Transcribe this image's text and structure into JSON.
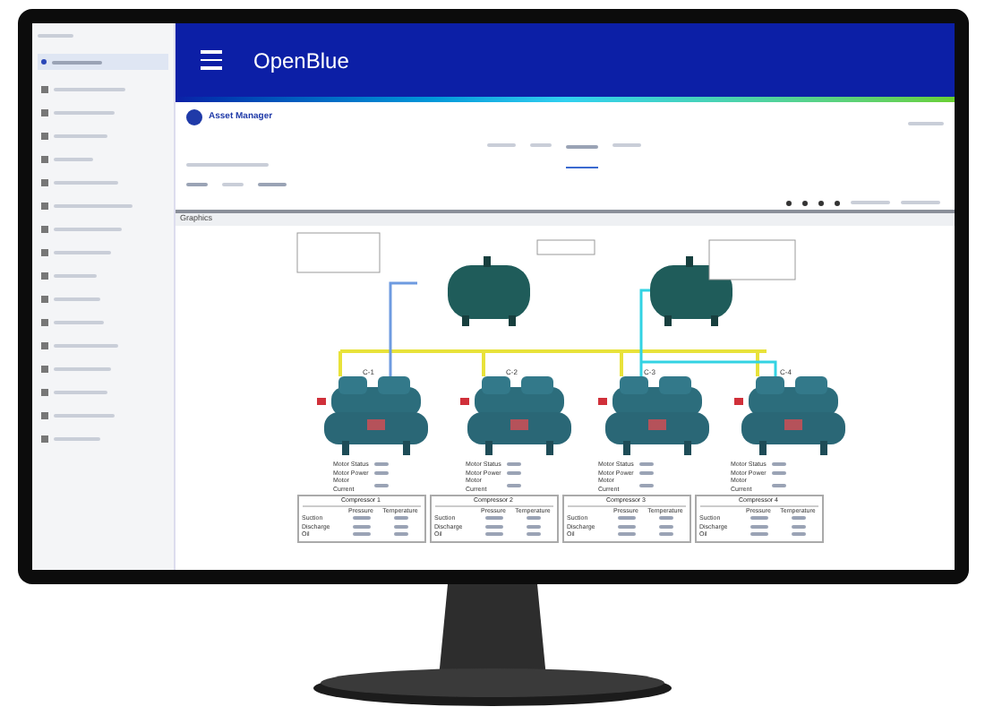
{
  "header": {
    "brand": "OpenBlue"
  },
  "sidebar": {
    "items": [
      {
        "selected": true
      },
      {
        "selected": false
      },
      {
        "selected": false
      },
      {
        "selected": false
      },
      {
        "selected": false
      },
      {
        "selected": false
      },
      {
        "selected": false
      },
      {
        "selected": false
      },
      {
        "selected": false
      },
      {
        "selected": false
      },
      {
        "selected": false
      },
      {
        "selected": false
      },
      {
        "selected": false
      },
      {
        "selected": false
      },
      {
        "selected": false
      },
      {
        "selected": false
      },
      {
        "selected": false
      }
    ]
  },
  "page": {
    "title": "Asset Manager"
  },
  "panel": {
    "title": "Graphics"
  },
  "compressors": [
    {
      "label": "C-1",
      "title": "Compressor 1",
      "status_labels": [
        "Motor Status",
        "Motor Power",
        "Motor Current"
      ],
      "rows": [
        "Suction",
        "Discharge",
        "Oil"
      ],
      "columns": [
        "Pressure",
        "Temperature"
      ]
    },
    {
      "label": "C-2",
      "title": "Compressor 2",
      "status_labels": [
        "Motor Status",
        "Motor Power",
        "Motor Current"
      ],
      "rows": [
        "Suction",
        "Discharge",
        "Oil"
      ],
      "columns": [
        "Pressure",
        "Temperature"
      ]
    },
    {
      "label": "C-3",
      "title": "Compressor 3",
      "status_labels": [
        "Motor Status",
        "Motor Power",
        "Motor Current"
      ],
      "rows": [
        "Suction",
        "Discharge",
        "Oil"
      ],
      "columns": [
        "Pressure",
        "Temperature"
      ]
    },
    {
      "label": "C-4",
      "title": "Compressor 4",
      "status_labels": [
        "Motor Status",
        "Motor Power",
        "Motor Current"
      ],
      "rows": [
        "Suction",
        "Discharge",
        "Oil"
      ],
      "columns": [
        "Pressure",
        "Temperature"
      ]
    }
  ]
}
